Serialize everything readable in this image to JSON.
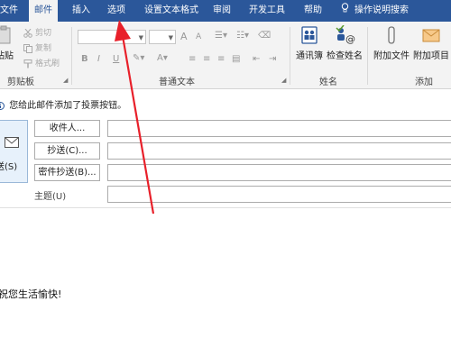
{
  "tabs": [
    {
      "label": "文件"
    },
    {
      "label": "邮件"
    },
    {
      "label": "插入"
    },
    {
      "label": "选项"
    },
    {
      "label": "设置文本格式"
    },
    {
      "label": "审阅"
    },
    {
      "label": "开发工具"
    },
    {
      "label": "帮助"
    },
    {
      "label": "操作说明搜索"
    }
  ],
  "clipboard": {
    "paste": "粘贴",
    "cut": "剪切",
    "copy": "复制",
    "format_painter": "格式刷",
    "group": "剪贴板"
  },
  "basic_text": {
    "bold": "B",
    "italic": "I",
    "underline": "U",
    "font_grow": "A",
    "font_shrink": "A",
    "group": "普通文本"
  },
  "names": {
    "address_book": "通讯簿",
    "check_names": "检查姓名",
    "group": "姓名"
  },
  "include": {
    "attach_file": "附加文件",
    "attach_item": "附加项目",
    "group": "添加"
  },
  "infobar": {
    "text": "您给此邮件添加了投票按钮。"
  },
  "compose": {
    "send": "送(S)",
    "to": "收件人...",
    "cc": "抄送(C)...",
    "bcc": "密件抄送(B)...",
    "subject": "主题(U)"
  },
  "body": {
    "text": "祝您生活愉快!"
  },
  "colors": {
    "ribbon_blue": "#2b579a",
    "arrow_red": "#e8202a"
  }
}
